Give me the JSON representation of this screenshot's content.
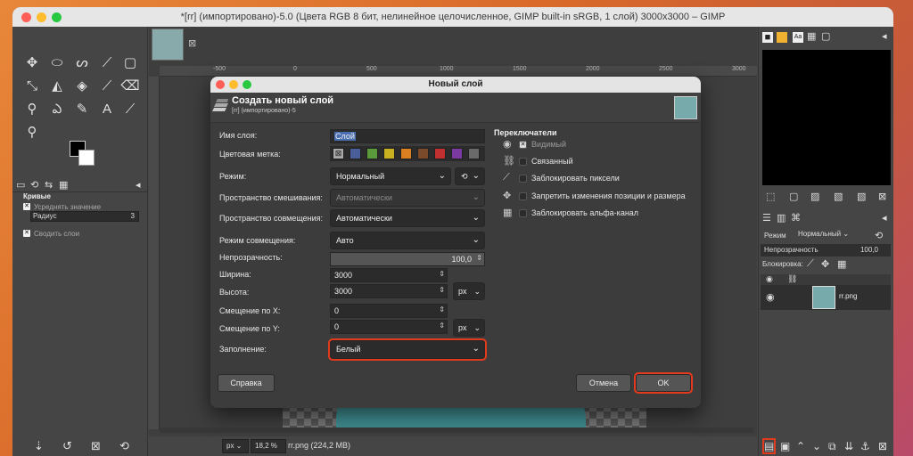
{
  "window": {
    "title": "*[rr] (импортировано)-5.0 (Цвета RGB 8 бит, нелинейное целочисленное, GIMP built-in sRGB, 1 слой) 3000x3000 – GIMP"
  },
  "toolbox": {
    "tools": [
      "move-icon",
      "ellipse-select-icon",
      "lasso-icon",
      "fuzzy-select-icon",
      "crop-icon",
      "transform-icon",
      "warp-icon",
      "cage-icon",
      "paint-icon",
      "path-icon",
      "text-icon",
      "clone-icon",
      "smudge-icon",
      "dodge-icon",
      "zoom-icon"
    ],
    "options": {
      "title": "Кривые",
      "smooth_label": "Усреднять значение",
      "radius_label": "Радиус",
      "radius_value": "3",
      "sample_merged_label": "Сводить слои"
    }
  },
  "canvas": {
    "ruler_ticks": [
      "-500",
      "0",
      "500",
      "1000",
      "1500",
      "2000",
      "2500",
      "3000"
    ],
    "status": {
      "unit": "px",
      "zoom": "18,2 %",
      "file": "rr.png (224,2 MB)"
    }
  },
  "right_panel": {
    "mode_label": "Режим",
    "mode_value": "Нормальный",
    "opacity_label": "Непрозрачность",
    "opacity_value": "100,0",
    "lock_label": "Блокировка:",
    "layer_name": "rr.png"
  },
  "dialog": {
    "title": "Новый слой",
    "header_title": "Создать новый слой",
    "header_subtitle": "[rr] (импортировано)-5",
    "fields": {
      "layer_name_label": "Имя слоя:",
      "layer_name_value": "Слой",
      "color_tag_label": "Цветовая метка:",
      "mode_label": "Режим:",
      "mode_value": "Нормальный",
      "blend_space_label": "Пространство смешивания:",
      "blend_space_value": "Автоматически",
      "composite_space_label": "Пространство совмещения:",
      "composite_space_value": "Автоматически",
      "composite_mode_label": "Режим совмещения:",
      "composite_mode_value": "Авто",
      "opacity_label": "Непрозрачность:",
      "opacity_value": "100,0",
      "width_label": "Ширина:",
      "width_value": "3000",
      "height_label": "Высота:",
      "height_value": "3000",
      "size_unit": "px",
      "offset_x_label": "Смещение по X:",
      "offset_x_value": "0",
      "offset_y_label": "Смещение по Y:",
      "offset_y_value": "0",
      "offset_unit": "px",
      "fill_label": "Заполнение:",
      "fill_value": "Белый"
    },
    "color_tags": [
      "#4a5f9a",
      "#5a9a3a",
      "#c9b020",
      "#d98020",
      "#7a4a2a",
      "#c03030",
      "#7a3aa0",
      "#6a6a6a"
    ],
    "switches": {
      "title": "Переключатели",
      "visible": "Видимый",
      "linked": "Связанный",
      "lock_pixels": "Заблокировать пиксели",
      "lock_position": "Запретить изменения позиции и размера",
      "lock_alpha": "Заблокировать альфа-канал"
    },
    "buttons": {
      "help": "Справка",
      "cancel": "Отмена",
      "ok": "OK"
    },
    "highlight_color": "#e23a1c"
  }
}
